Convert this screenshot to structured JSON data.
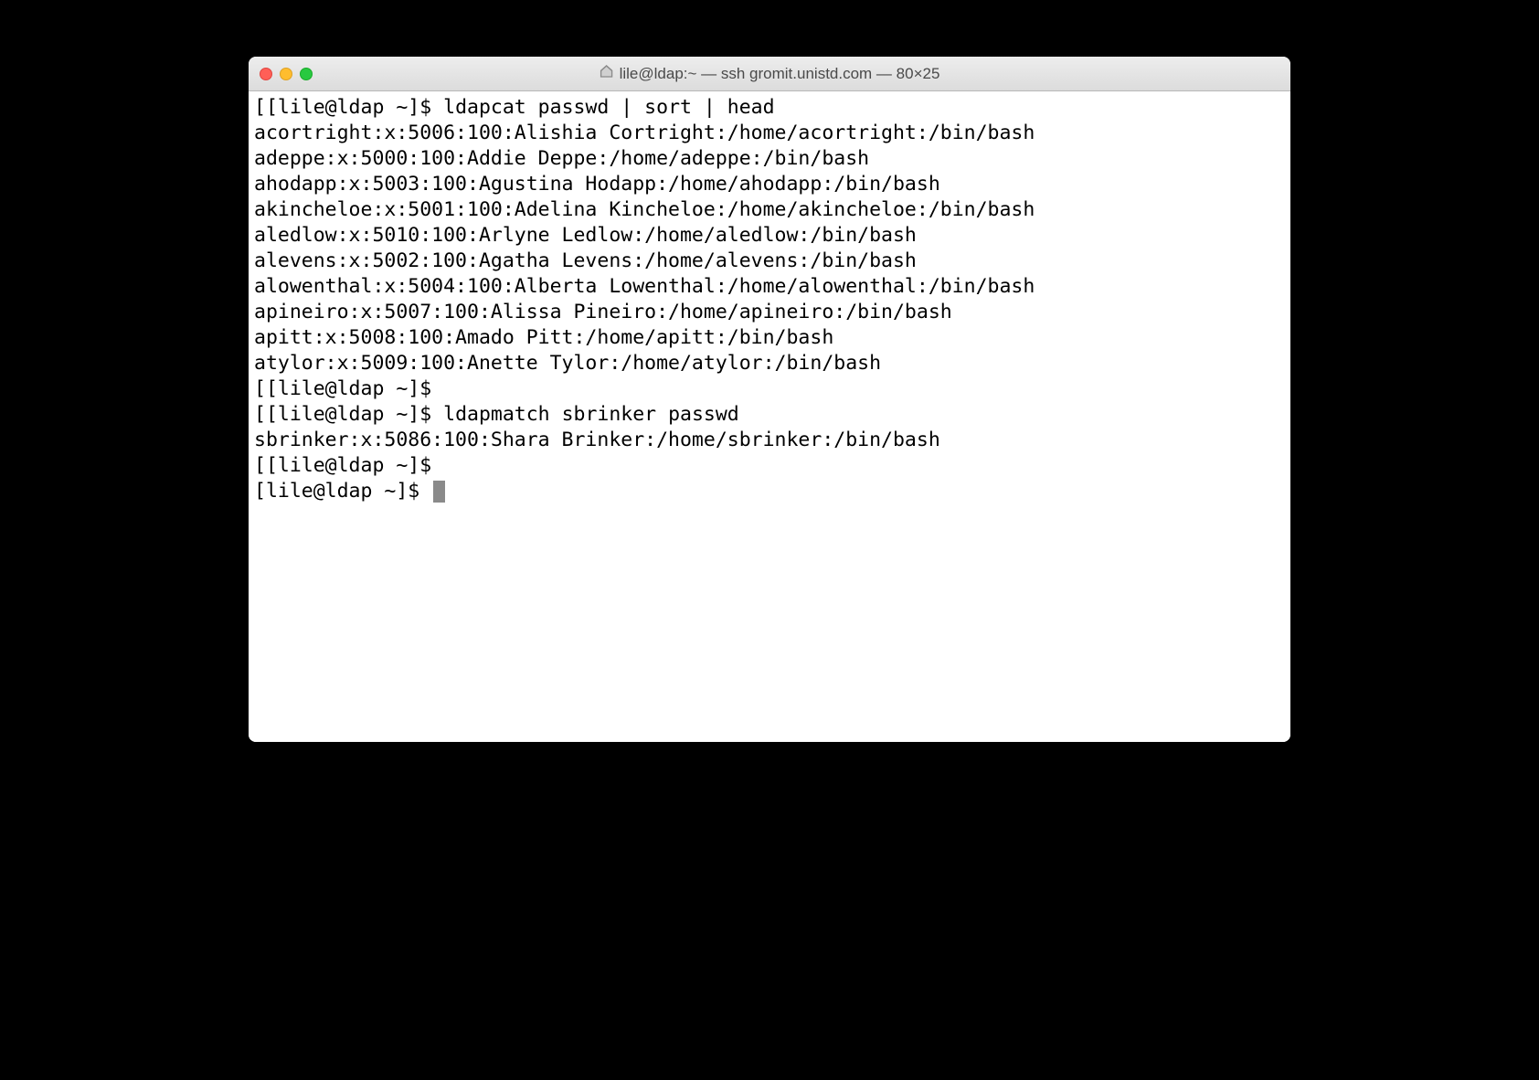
{
  "window": {
    "title": "lile@ldap:~ — ssh gromit.unistd.com — 80×25"
  },
  "terminal": {
    "prompt": "[lile@ldap ~]$ ",
    "open_bracket": "[",
    "close_bracket": "]",
    "command1": "ldapcat passwd | sort | head",
    "output1": [
      "acortright:x:5006:100:Alishia Cortright:/home/acortright:/bin/bash",
      "adeppe:x:5000:100:Addie Deppe:/home/adeppe:/bin/bash",
      "ahodapp:x:5003:100:Agustina Hodapp:/home/ahodapp:/bin/bash",
      "akincheloe:x:5001:100:Adelina Kincheloe:/home/akincheloe:/bin/bash",
      "aledlow:x:5010:100:Arlyne Ledlow:/home/aledlow:/bin/bash",
      "alevens:x:5002:100:Agatha Levens:/home/alevens:/bin/bash",
      "alowenthal:x:5004:100:Alberta Lowenthal:/home/alowenthal:/bin/bash",
      "apineiro:x:5007:100:Alissa Pineiro:/home/apineiro:/bin/bash",
      "apitt:x:5008:100:Amado Pitt:/home/apitt:/bin/bash",
      "atylor:x:5009:100:Anette Tylor:/home/atylor:/bin/bash"
    ],
    "command2": "ldapmatch sbrinker passwd",
    "output2": [
      "sbrinker:x:5086:100:Shara Brinker:/home/sbrinker:/bin/bash"
    ]
  }
}
